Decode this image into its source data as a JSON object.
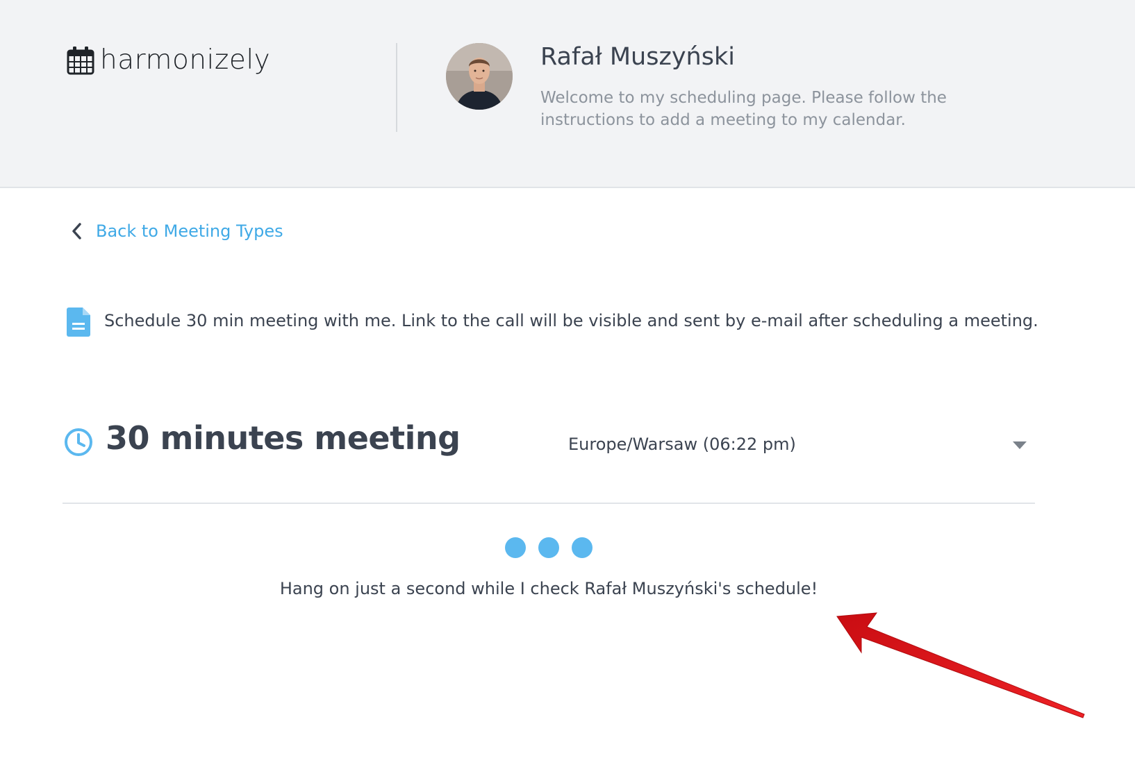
{
  "brand": {
    "name": "harmonizely",
    "icon": "calendar-icon"
  },
  "host": {
    "name": "Rafał Muszyński",
    "welcome": "Welcome to my scheduling page. Please follow the instructions to add a meeting to my calendar."
  },
  "nav": {
    "back_label": "Back to Meeting Types",
    "back_icon": "chevron-left-icon"
  },
  "meeting": {
    "description": "Schedule 30 min meeting with me. Link to the call will be visible and sent by e-mail after scheduling a meeting.",
    "description_icon": "document-icon",
    "title": "30 minutes meeting",
    "title_icon": "clock-icon",
    "timezone": "Europe/Warsaw (06:22 pm)"
  },
  "loading": {
    "message": "Hang on just a second while I check Rafał Muszyński's schedule!",
    "dot_count": 3
  },
  "colors": {
    "accent": "#3fa9e6",
    "loader_dot": "#5bb8ef",
    "header_bg": "#f2f3f5",
    "annotation_arrow": "#e3161b"
  }
}
